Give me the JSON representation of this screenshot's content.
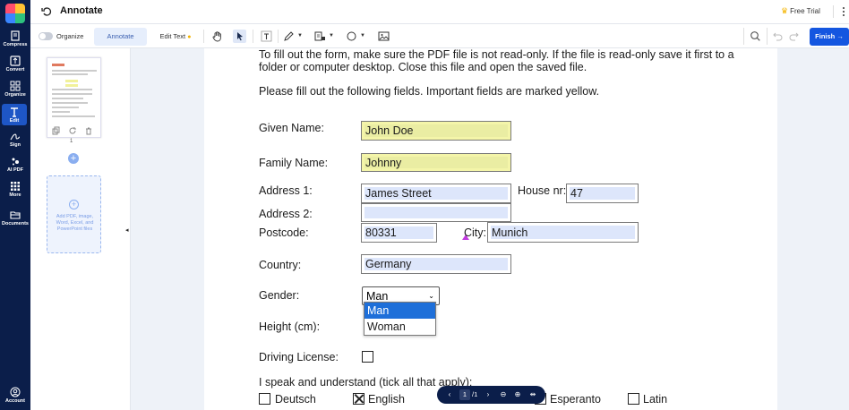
{
  "app": {
    "title": "Annotate",
    "free_trial": "Free Trial",
    "finish": "Finish"
  },
  "rail": {
    "items": [
      {
        "label": "Compress",
        "icon": "compress-icon"
      },
      {
        "label": "Convert",
        "icon": "convert-icon"
      },
      {
        "label": "Organize",
        "icon": "organize-icon"
      },
      {
        "label": "Edit",
        "icon": "edit-text-icon",
        "active": true
      },
      {
        "label": "Sign",
        "icon": "sign-icon"
      },
      {
        "label": "AI PDF",
        "icon": "ai-sparkle-icon"
      },
      {
        "label": "More",
        "icon": "grid-icon"
      },
      {
        "label": "Documents",
        "icon": "folder-icon"
      },
      {
        "label": "Account",
        "icon": "account-icon"
      }
    ]
  },
  "toolbar": {
    "organize_label": "Organize",
    "annotate_tab": "Annotate",
    "edit_text_tab": "Edit Text",
    "tools": [
      "hand-icon",
      "cursor-icon",
      "text-box-icon",
      "pen-icon",
      "stamp-icon",
      "circle-shape-icon",
      "image-icon",
      "search-icon",
      "undo-icon",
      "redo-icon"
    ]
  },
  "thumbnails": {
    "page_number": "1",
    "drop_text": "Add PDF, image, Word, Excel, and PowerPoint files"
  },
  "document": {
    "intro1": "To fill out the form, make sure the PDF file is not read-only. If the file is read-only save it first to a",
    "intro2": "folder or computer desktop. Close this file and open the saved file.",
    "intro3": "Please fill out the following fields. Important fields are marked yellow.",
    "labels": {
      "given_name": "Given Name:",
      "family_name": "Family Name:",
      "address1": "Address 1:",
      "house_nr": "House nr:",
      "address2": "Address 2:",
      "postcode": "Postcode:",
      "city": "City:",
      "country": "Country:",
      "gender": "Gender:",
      "height": "Height (cm):",
      "driving_license": "Driving License:",
      "languages": "I speak and understand (tick all that apply):"
    },
    "values": {
      "given_name": "John Doe",
      "family_name": "Johnny",
      "address1": "James Street",
      "house_nr": "47",
      "address2": "",
      "postcode": "80331",
      "city": "Munich",
      "country": "Germany",
      "gender": "Man"
    },
    "gender_options": [
      "Man",
      "Woman"
    ],
    "languages": [
      {
        "name": "Deutsch",
        "checked": false
      },
      {
        "name": "English",
        "checked": true
      },
      {
        "name": "Esperanto",
        "checked": false
      },
      {
        "name": "Latin",
        "checked": false
      }
    ]
  },
  "nav": {
    "current_page": "1",
    "total": "/1"
  }
}
